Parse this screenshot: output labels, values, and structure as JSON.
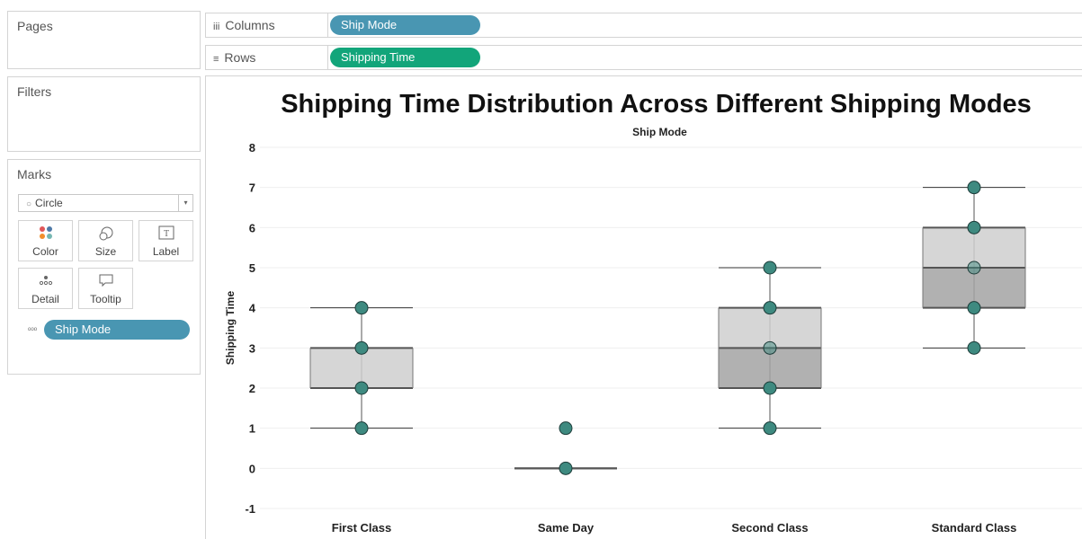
{
  "side_panel": {
    "pages_label": "Pages",
    "filters_label": "Filters",
    "marks_label": "Marks",
    "mark_type": "Circle",
    "mark_buttons": {
      "color": "Color",
      "size": "Size",
      "label": "Label",
      "detail": "Detail",
      "tooltip": "Tooltip"
    },
    "detail_pill": "Ship Mode"
  },
  "shelves": {
    "columns_label": "Columns",
    "columns_pill": "Ship Mode",
    "rows_label": "Rows",
    "rows_pill": "Shipping Time"
  },
  "colors": {
    "pill_blue": "#4996b2",
    "pill_green": "#12a57a",
    "point_fill": "#3e8a80",
    "box_upper": "#cfcfcf",
    "box_lower": "#a3a3a3"
  },
  "chart_data": {
    "type": "box",
    "title": "Shipping Time Distribution Across Different Shipping Modes",
    "x_header": "Ship Mode",
    "ylabel": "Shipping Time",
    "ylim": [
      -1,
      8
    ],
    "yticks": [
      -1,
      0,
      1,
      2,
      3,
      4,
      5,
      6,
      7,
      8
    ],
    "grid": true,
    "categories": [
      "First Class",
      "Same Day",
      "Second Class",
      "Standard Class"
    ],
    "boxes": [
      {
        "category": "First Class",
        "whisker_low": 1,
        "q1": 2,
        "median": 2,
        "q3": 3,
        "whisker_high": 4,
        "points": [
          1,
          2,
          3,
          4
        ]
      },
      {
        "category": "Same Day",
        "whisker_low": 0,
        "q1": 0,
        "median": 0,
        "q3": 0,
        "whisker_high": 0,
        "points": [
          0,
          1
        ]
      },
      {
        "category": "Second Class",
        "whisker_low": 1,
        "q1": 2,
        "median": 3,
        "q3": 4,
        "whisker_high": 5,
        "points": [
          1,
          2,
          3,
          4,
          5
        ]
      },
      {
        "category": "Standard Class",
        "whisker_low": 3,
        "q1": 4,
        "median": 5,
        "q3": 6,
        "whisker_high": 7,
        "points": [
          3,
          4,
          5,
          6,
          7
        ]
      }
    ]
  }
}
